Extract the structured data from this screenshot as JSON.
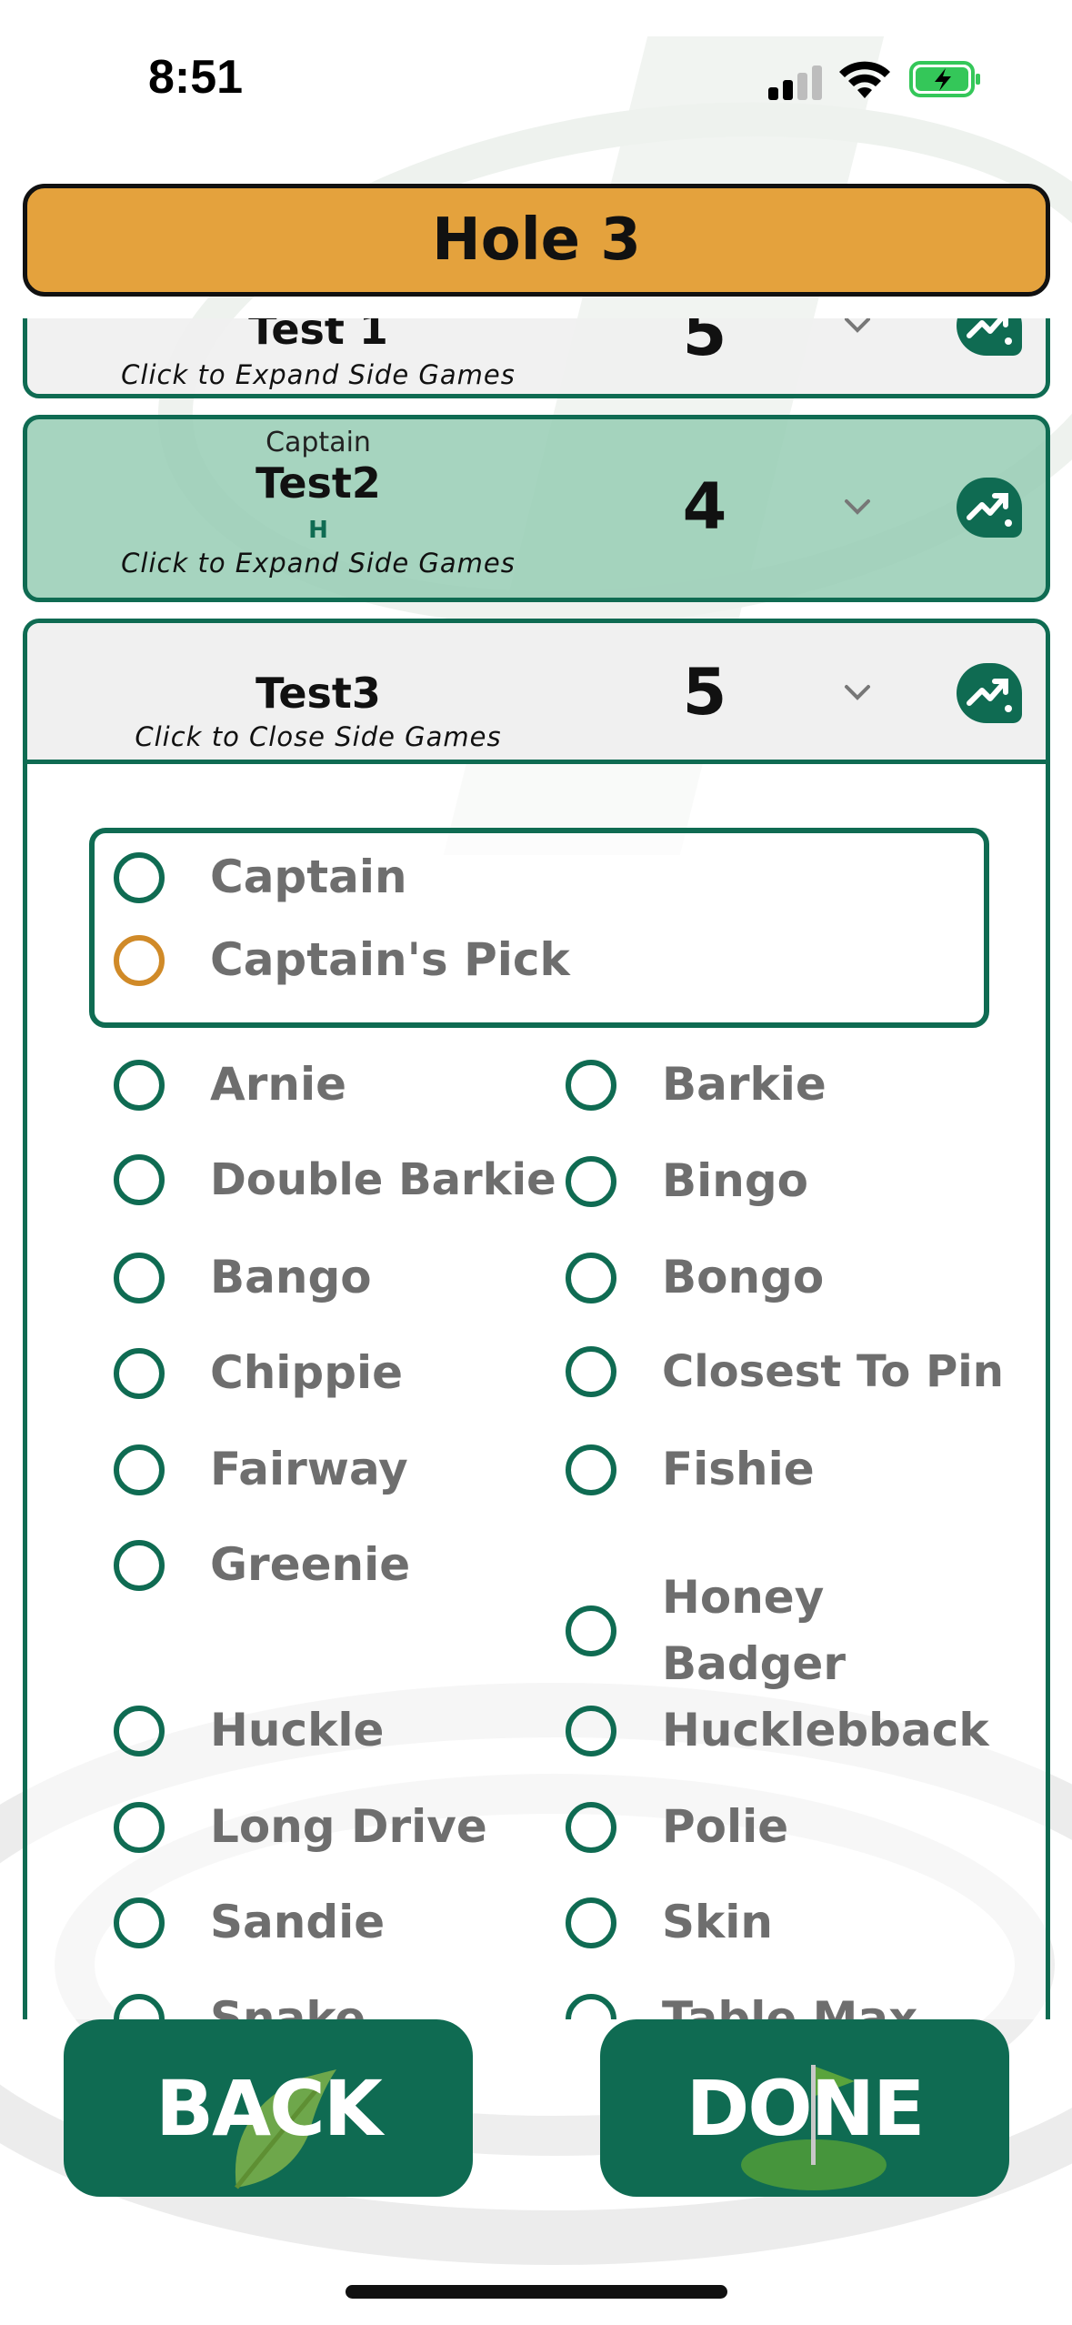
{
  "status_bar": {
    "time": "8:51",
    "colors": {
      "battery": "#34c759",
      "battery_bolt": "#000000"
    }
  },
  "header": {
    "title": "Hole 3",
    "color": "#e4a23d"
  },
  "players": [
    {
      "name": "Test 1",
      "role": "",
      "handicap": "",
      "score": "5",
      "hint": "Click to Expand Side Games"
    },
    {
      "name": "Test2",
      "role": "Captain",
      "handicap": "H",
      "score": "4",
      "hint": "Click to Expand Side Games"
    },
    {
      "name": "Test3",
      "role": "",
      "handicap": "",
      "score": "5",
      "hint": "Click to Close Side Games"
    }
  ],
  "captain_options": [
    {
      "label": "Captain",
      "selected": false
    },
    {
      "label": "Captain's Pick",
      "selected": false
    }
  ],
  "side_games": {
    "left": [
      "Arnie",
      "Double Barkie",
      "Bango",
      "Chippie",
      "Fairway",
      "Greenie",
      "Huckle",
      "Long Drive",
      "Sandie",
      "Snake"
    ],
    "right": [
      "Barkie",
      "Bingo",
      "Bongo",
      "Closest To Pin",
      "Fishie",
      "Honey Badger",
      "Hucklebback",
      "Polie",
      "Skin",
      "Table Max"
    ]
  },
  "buttons": {
    "back": "BACK",
    "done": "DONE"
  },
  "colors": {
    "primary": "#0f6b52",
    "option_text": "#6e6e6e",
    "captain_pick_ring": "#d08a28"
  },
  "icons": [
    "signal-icon",
    "wifi-icon",
    "battery-charging-icon",
    "chevron-down-icon",
    "stats-trend-icon"
  ]
}
